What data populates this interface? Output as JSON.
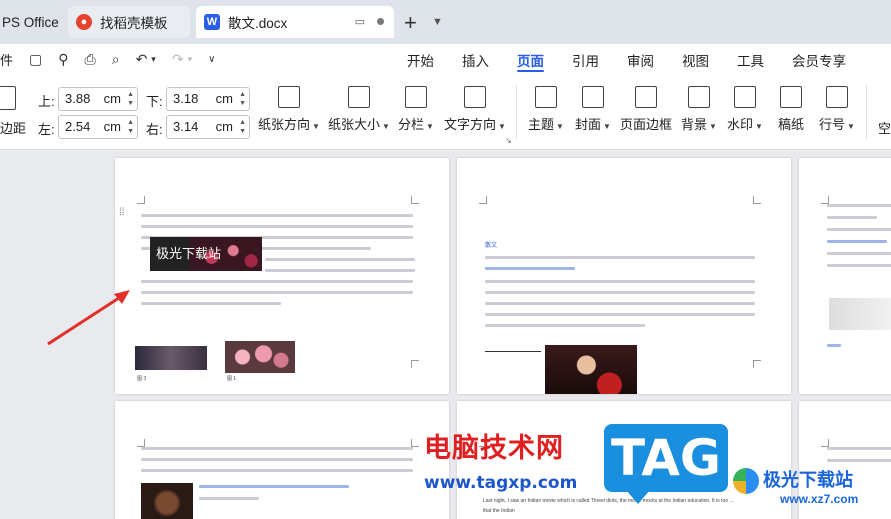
{
  "tabs": [
    {
      "label": "PS Office"
    },
    {
      "label": "找稻壳模板"
    },
    {
      "label": "散文.docx"
    }
  ],
  "menu": {
    "left_partial": "件",
    "tabs": [
      "开始",
      "插入",
      "页面",
      "引用",
      "审阅",
      "视图",
      "工具",
      "会员专享"
    ],
    "active_tab": "页面"
  },
  "ribbon": {
    "margin_label": "边距",
    "top_label": "上:",
    "top_value": "3.88",
    "bottom_label": "下:",
    "bottom_value": "3.18",
    "left_label": "左:",
    "left_value": "2.54",
    "right_label": "右:",
    "right_value": "3.14",
    "unit": "cm",
    "buttons": [
      "纸张方向",
      "纸张大小",
      "分栏",
      "文字方向",
      "主题",
      "封面",
      "页面边框",
      "背景",
      "水印",
      "稿纸",
      "行号"
    ],
    "trailing_partial": "空"
  },
  "document": {
    "overlay_text": "极光下载站",
    "caption1": "图 3",
    "caption2": "图 1",
    "page2_heading": "散文",
    "page5_line1": "Last night, I saw an Indian movie which is called Threel diots, the movie mocks at the Indian education. It is too ...",
    "page5_line2": "that the Indian"
  },
  "watermark": {
    "brand_cn": "电脑技术网",
    "brand_url": "www.tagxp.com",
    "tag": "TAG",
    "xz_name": "极光下载站",
    "xz_url": "www.xz7.com"
  }
}
